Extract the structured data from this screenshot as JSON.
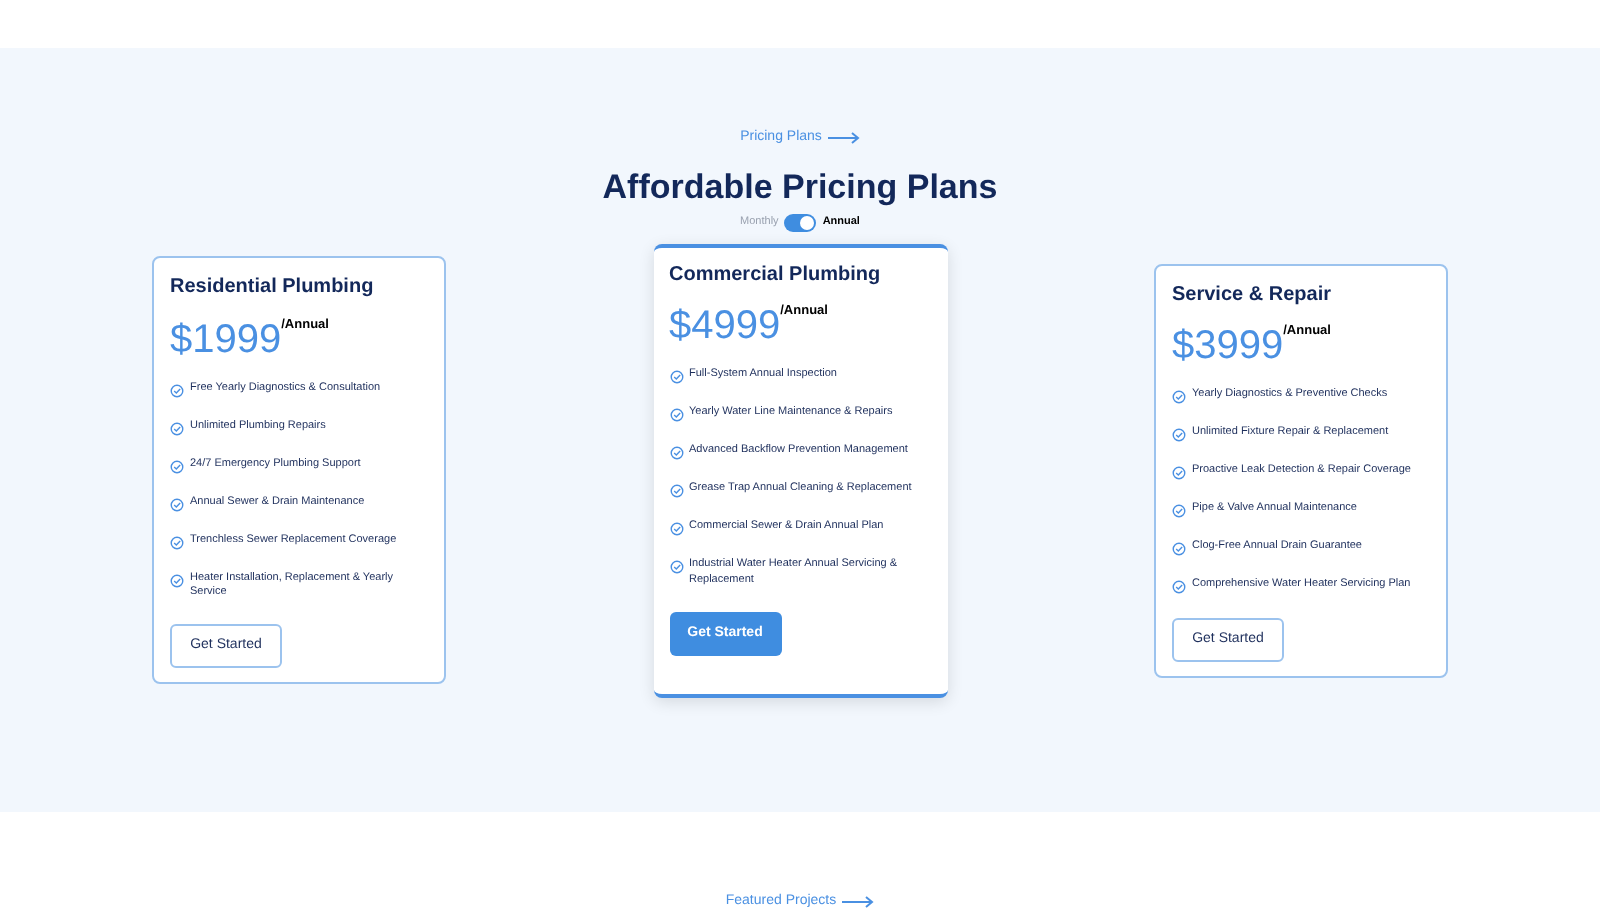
{
  "section_link": {
    "label": "Pricing Plans"
  },
  "title": "Affordable Pricing Plans",
  "billing_toggle": {
    "monthly_label": "Monthly",
    "annual_label": "Annual",
    "on": true
  },
  "plans": [
    {
      "name": "Residential Plumbing",
      "price": "$1999",
      "period": "/Annual",
      "featured": false,
      "features": [
        "Free Yearly Diagnostics & Consultation",
        "Unlimited Plumbing Repairs",
        "24/7 Emergency Plumbing Support",
        "Annual Sewer & Drain Maintenance",
        "Trenchless Sewer Replacement Coverage",
        "Heater Installation, Replacement & Yearly Service"
      ],
      "button": "Get Started"
    },
    {
      "name": "Commercial Plumbing",
      "price": "$4999",
      "period": "/Annual",
      "featured": true,
      "features": [
        "Full-System Annual Inspection",
        "Yearly Water Line Maintenance & Repairs",
        "Advanced Backflow Prevention Management",
        "Grease Trap Annual Cleaning & Replacement",
        "Commercial Sewer & Drain Annual Plan",
        "Industrial Water Heater Annual Servicing & Replacement"
      ],
      "button": "Get Started"
    },
    {
      "name": "Service & Repair",
      "price": "$3999",
      "period": "/Annual",
      "featured": false,
      "features": [
        "Yearly Diagnostics & Preventive Checks",
        "Unlimited Fixture Repair & Replacement",
        "Proactive Leak Detection & Repair Coverage",
        "Pipe & Valve Annual Maintenance",
        "Clog-Free Annual Drain Guarantee",
        "Comprehensive Water Heater Servicing Plan"
      ],
      "button": "Get Started"
    }
  ],
  "next_section_link": {
    "label": "Featured Projects"
  }
}
